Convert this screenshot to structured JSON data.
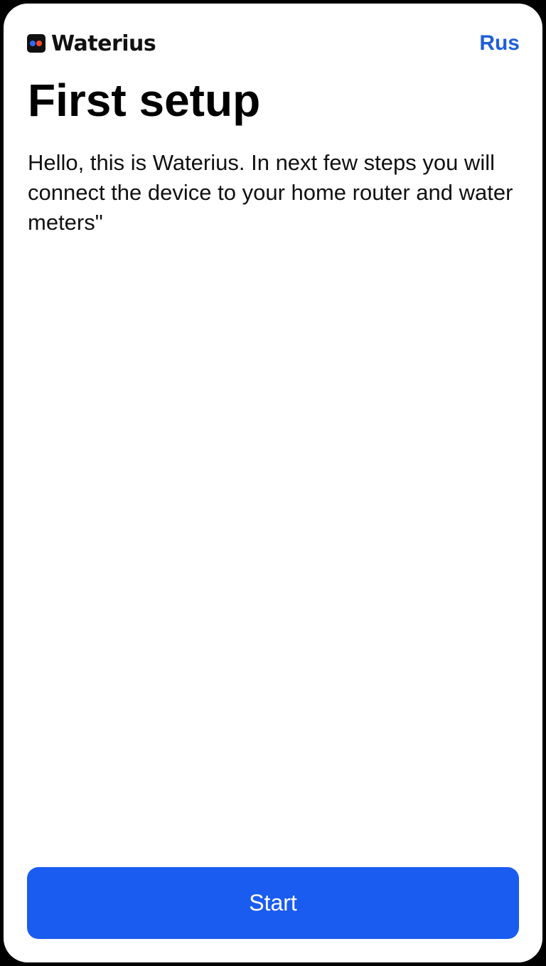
{
  "header": {
    "logo": {
      "name": "Waterius",
      "icon": "waterius-logo-icon"
    },
    "language_label": "Rus"
  },
  "main": {
    "title": "First setup",
    "description": "Hello, this is Waterius. In next few steps you will connect the device to your home router and water meters\""
  },
  "footer": {
    "start_label": "Start"
  },
  "colors": {
    "accent": "#1a5cf0",
    "link": "#1f5fd6",
    "logo_dot_blue": "#2f6bff",
    "logo_dot_red": "#ff4a2a"
  }
}
